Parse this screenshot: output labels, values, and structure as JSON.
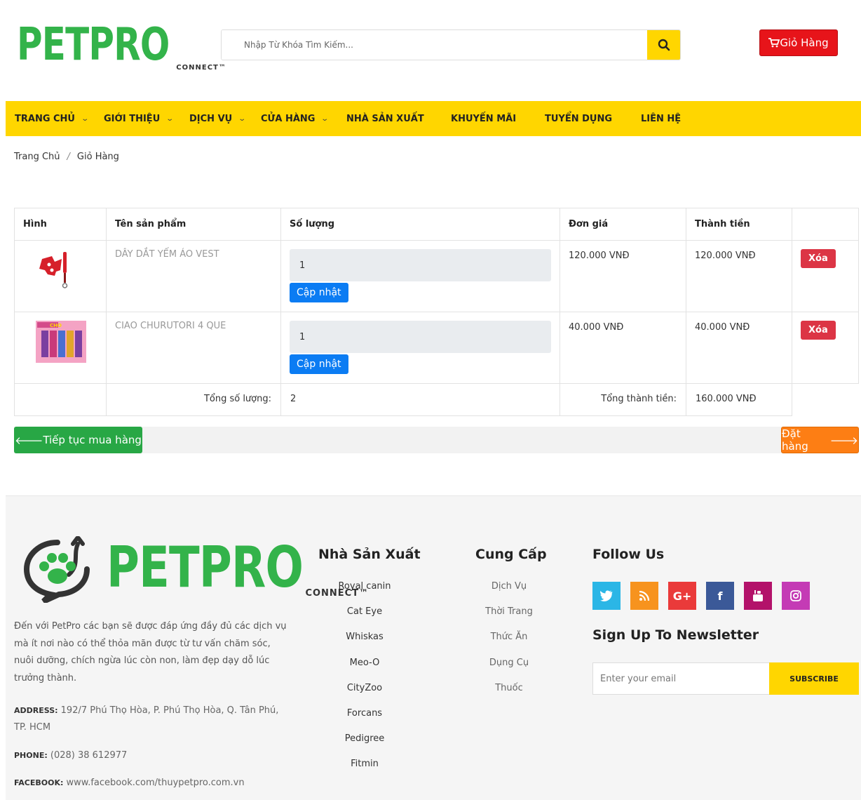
{
  "header": {
    "logo_text": "PETPRO",
    "logo_sub": "CONNECT™",
    "search_placeholder": "Nhập Từ Khóa Tìm Kiếm...",
    "cart_label": "Giỏ Hàng"
  },
  "nav": [
    {
      "label": "TRANG CHỦ",
      "dropdown": true
    },
    {
      "label": "GIỚI THIỆU",
      "dropdown": true
    },
    {
      "label": "DỊCH VỤ",
      "dropdown": true
    },
    {
      "label": "CỬA HÀNG",
      "dropdown": true
    },
    {
      "label": "NHÀ SẢN XUẤT",
      "dropdown": false
    },
    {
      "label": "KHUYẾN MÃI",
      "dropdown": false
    },
    {
      "label": "TUYỂN DỤNG",
      "dropdown": false
    },
    {
      "label": "LIÊN HỆ",
      "dropdown": false
    }
  ],
  "breadcrumb": {
    "home": "Trang Chủ",
    "sep": "/",
    "current": "Giỏ Hàng"
  },
  "cart": {
    "headers": {
      "image": "Hình",
      "name": "Tên sản phẩm",
      "qty": "Số lượng",
      "unit_price": "Đơn giá",
      "total": "Thành tiền"
    },
    "items": [
      {
        "name": "DÂY DẮT YẾM ÁO VEST",
        "qty": "1",
        "update": "Cập nhật",
        "unit_price": "120.000 VNĐ",
        "total": "120.000 VNĐ",
        "delete": "Xóa"
      },
      {
        "name": "CIAO CHURUTORI 4 QUE",
        "qty": "1",
        "update": "Cập nhật",
        "unit_price": "40.000 VNĐ",
        "total": "40.000 VNĐ",
        "delete": "Xóa"
      }
    ],
    "total_qty_label": "Tổng số lượng:",
    "total_qty": "2",
    "total_amount_label": "Tổng thành tiền:",
    "total_amount": "160.000 VNĐ",
    "continue_label": "Tiếp tục mua hàng",
    "order_label": "Đặt hàng"
  },
  "footer": {
    "about": "Đến với PetPro các bạn sẽ được đáp ứng đầy đủ các dịch vụ mà ít nơi nào có thể thỏa mãn được từ tư vấn chăm sóc, nuôi dưỡng, chích ngừa lúc còn non, làm đẹp dạy dỗ lúc trưởng thành.",
    "address_label": "ADDRESS:",
    "address": "192/7 Phú Thọ Hòa, P. Phú Thọ Hòa, Q. Tân Phú, TP. HCM",
    "phone_label": "PHONE:",
    "phone": "(028) 38 612977",
    "facebook_label": "FACEBOOK:",
    "facebook": "www.facebook.com/thuypetpro.com.vn",
    "manufacturers_title": "Nhà Sản Xuất",
    "manufacturers": [
      "Royal canin",
      "Cat Eye",
      "Whiskas",
      "Meo-O",
      "CityZoo",
      "Forcans",
      "Pedigree",
      "Fitmin"
    ],
    "supply_title": "Cung Cấp",
    "supply": [
      "Dịch Vụ",
      "Thời Trang",
      "Thức Ăn",
      "Dụng Cụ",
      "Thuốc"
    ],
    "follow_title": "Follow Us",
    "social": [
      {
        "icon": "twitter-icon",
        "glyph": "t",
        "color": "#2bb6e6"
      },
      {
        "icon": "rss-icon",
        "glyph": ")",
        "color": "#f7931e"
      },
      {
        "icon": "google-plus-icon",
        "glyph": "G+",
        "color": "#ea3a3a"
      },
      {
        "icon": "facebook-icon",
        "glyph": "f",
        "color": "#3b5998"
      },
      {
        "icon": "youtube-icon",
        "glyph": "▶",
        "color": "#b3126a"
      },
      {
        "icon": "instagram-icon",
        "glyph": "◎",
        "color": "#c43bb5"
      }
    ],
    "newsletter_title": "Sign Up To Newsletter",
    "newsletter_placeholder": "Enter your email",
    "subscribe_label": "SUBSCRIBE"
  }
}
